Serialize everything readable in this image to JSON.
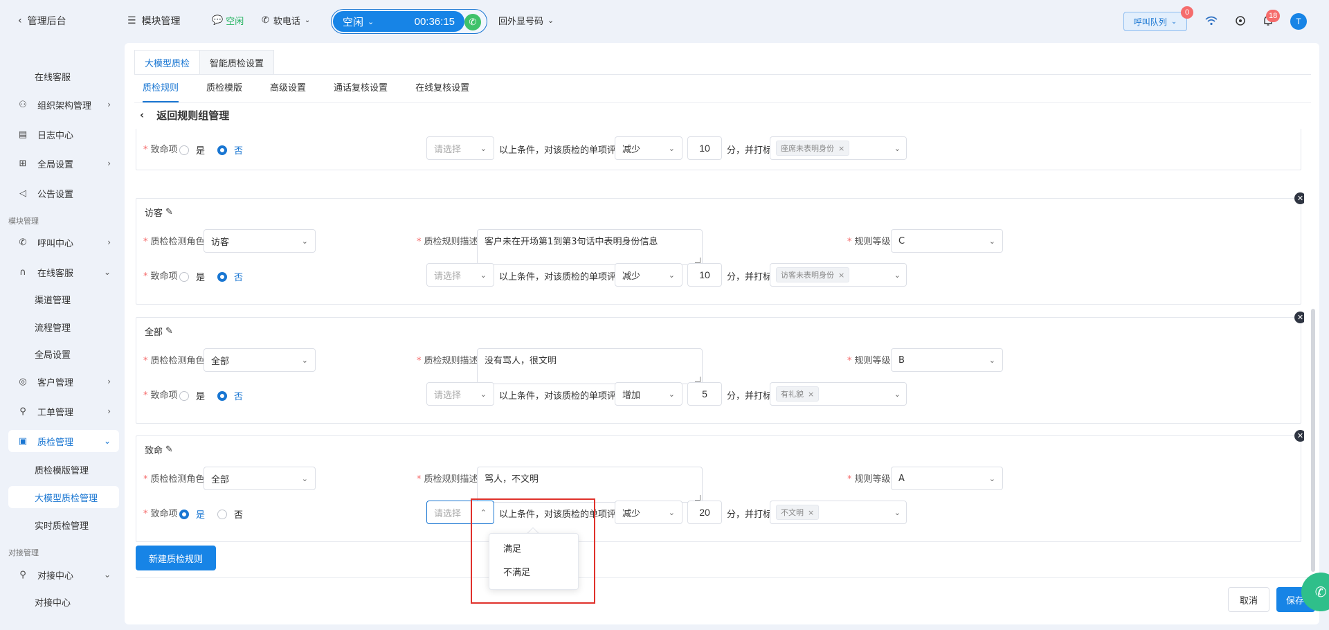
{
  "topbar": {
    "back_label": "管理后台",
    "module_label": "模块管理",
    "status_text": "空闲",
    "phone_label": "软电话",
    "call_status": "空闲",
    "call_timer": "00:36:15",
    "outbound_label": "回外显号码",
    "queue_label": "呼叫队列",
    "queue_badge": "0",
    "notice_badge": "18",
    "avatar_letter": "T"
  },
  "sidebar": {
    "top_sub": "在线客服",
    "items": [
      {
        "label": "组织架构管理",
        "icon": "org-icon"
      },
      {
        "label": "日志中心",
        "icon": "log-icon"
      },
      {
        "label": "全局设置",
        "icon": "settings-icon"
      },
      {
        "label": "公告设置",
        "icon": "megaphone-icon"
      }
    ],
    "group_module": "模块管理",
    "module_items": [
      {
        "label": "呼叫中心",
        "icon": "phone-icon"
      },
      {
        "label": "在线客服",
        "icon": "headset-icon"
      }
    ],
    "online_sub": [
      "渠道管理",
      "流程管理",
      "全局设置"
    ],
    "more_items": [
      {
        "label": "客户管理",
        "icon": "user-icon"
      },
      {
        "label": "工单管理",
        "icon": "ticket-icon"
      },
      {
        "label": "质检管理",
        "icon": "inspect-icon"
      }
    ],
    "qc_sub": [
      "质检模版管理",
      "大模型质检管理",
      "实时质检管理"
    ],
    "group_dock": "对接管理",
    "dock_item": {
      "label": "对接中心",
      "icon": "link-icon"
    },
    "dock_sub": "对接中心"
  },
  "main": {
    "tabs": [
      "大模型质检",
      "智能质检设置"
    ],
    "subtabs": [
      "质检规则",
      "质检模版",
      "高级设置",
      "通话复核设置",
      "在线复核设置"
    ],
    "back_label": "返回规则组管理"
  },
  "labels": {
    "role": "质检检测角色",
    "desc": "质检规则描述",
    "level": "规则等级",
    "fatal": "致命项",
    "yes": "是",
    "no": "否",
    "cond_placeholder": "请选择",
    "cond_text": "以上条件，对该质检的单项评分",
    "score_suffix": "分，并打标签"
  },
  "rules": [
    {
      "title": "",
      "fatal": "否",
      "op": "减少",
      "score": "10",
      "tag": "座席未表明身份"
    },
    {
      "title": "访客",
      "role": "访客",
      "desc": "客户未在开场第1到第3句话中表明身份信息",
      "level": "C",
      "fatal": "否",
      "op": "减少",
      "score": "10",
      "tag": "访客未表明身份"
    },
    {
      "title": "全部",
      "role": "全部",
      "desc": "没有骂人，很文明",
      "level": "B",
      "fatal": "否",
      "op": "增加",
      "score": "5",
      "tag": "有礼貌"
    },
    {
      "title": "致命",
      "role": "全部",
      "desc": "骂人，不文明",
      "level": "A",
      "fatal": "是",
      "op": "减少",
      "score": "20",
      "tag": "不文明"
    }
  ],
  "dropdown": {
    "options": [
      "满足",
      "不满足"
    ]
  },
  "buttons": {
    "new_rule": "新建质检规则",
    "cancel": "取消",
    "save": "保存"
  },
  "colors": {
    "primary": "#1784e6",
    "success": "#3fc26a",
    "danger": "#f56c6c",
    "highlight": "#e0312b"
  }
}
